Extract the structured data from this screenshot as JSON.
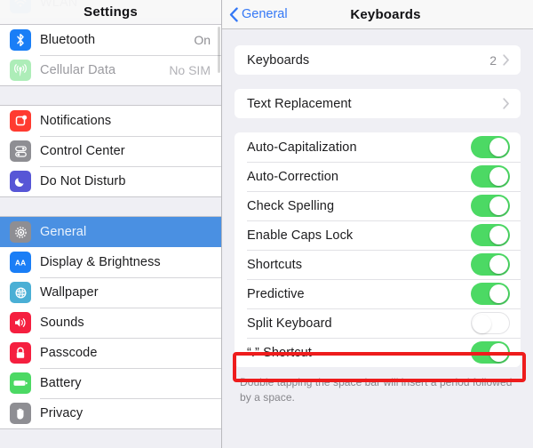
{
  "sidebar": {
    "title": "Settings",
    "cut_off_row": {
      "label": "WLAN",
      "value": "",
      "icon": "wifi-icon"
    },
    "groups": [
      {
        "items": [
          {
            "label": "Bluetooth",
            "value": "On",
            "icon": "bluetooth-icon",
            "icon_color": "#1a7ef6",
            "selected": false,
            "faded": false
          },
          {
            "label": "Cellular Data",
            "value": "No SIM",
            "icon": "cellular-icon",
            "icon_color": "#4cd964",
            "selected": false,
            "faded": true
          }
        ]
      },
      {
        "items": [
          {
            "label": "Notifications",
            "value": "",
            "icon": "notifications-icon",
            "icon_color": "#ff3b30",
            "selected": false,
            "faded": false
          },
          {
            "label": "Control Center",
            "value": "",
            "icon": "control-center-icon",
            "icon_color": "#8e8e93",
            "selected": false,
            "faded": false
          },
          {
            "label": "Do Not Disturb",
            "value": "",
            "icon": "do-not-disturb-icon",
            "icon_color": "#5756d6",
            "selected": false,
            "faded": false
          }
        ]
      },
      {
        "items": [
          {
            "label": "General",
            "value": "",
            "icon": "gear-icon",
            "icon_color": "#8e8e93",
            "selected": true,
            "faded": false
          },
          {
            "label": "Display & Brightness",
            "value": "",
            "icon": "display-brightness-icon",
            "icon_color": "#1a7ef6",
            "selected": false,
            "faded": false
          },
          {
            "label": "Wallpaper",
            "value": "",
            "icon": "wallpaper-icon",
            "icon_color": "#4aafd5",
            "selected": false,
            "faded": false
          },
          {
            "label": "Sounds",
            "value": "",
            "icon": "sounds-icon",
            "icon_color": "#f51f3f",
            "selected": false,
            "faded": false
          },
          {
            "label": "Passcode",
            "value": "",
            "icon": "passcode-lock-icon",
            "icon_color": "#f51f3f",
            "selected": false,
            "faded": false
          },
          {
            "label": "Battery",
            "value": "",
            "icon": "battery-icon",
            "icon_color": "#4cd964",
            "selected": false,
            "faded": false
          },
          {
            "label": "Privacy",
            "value": "",
            "icon": "privacy-hand-icon",
            "icon_color": "#8e8e93",
            "selected": false,
            "faded": false
          }
        ]
      }
    ]
  },
  "detail": {
    "back_label": "General",
    "title": "Keyboards",
    "group1": [
      {
        "label": "Keyboards",
        "value": "2",
        "type": "disclosure"
      }
    ],
    "group2": [
      {
        "label": "Text Replacement",
        "value": "",
        "type": "disclosure"
      }
    ],
    "group3": [
      {
        "label": "Auto-Capitalization",
        "type": "switch",
        "on": true
      },
      {
        "label": "Auto-Correction",
        "type": "switch",
        "on": true
      },
      {
        "label": "Check Spelling",
        "type": "switch",
        "on": true
      },
      {
        "label": "Enable Caps Lock",
        "type": "switch",
        "on": true
      },
      {
        "label": "Shortcuts",
        "type": "switch",
        "on": true
      },
      {
        "label": "Predictive",
        "type": "switch",
        "on": true
      },
      {
        "label": "Split Keyboard",
        "type": "switch",
        "on": false,
        "highlighted": true
      },
      {
        "label": "“.” Shortcut",
        "type": "switch",
        "on": true
      }
    ],
    "footer_note": "Double tapping the space bar will insert a period followed by a space."
  },
  "annotation": {
    "color": "#ee1c1c",
    "target_label": "Split Keyboard"
  },
  "colors": {
    "selection_blue": "#4a90e2",
    "switch_on_green": "#4cd964",
    "link_blue": "#3478f6",
    "panel_bg": "#efeff4",
    "card_white": "#ffffff"
  }
}
